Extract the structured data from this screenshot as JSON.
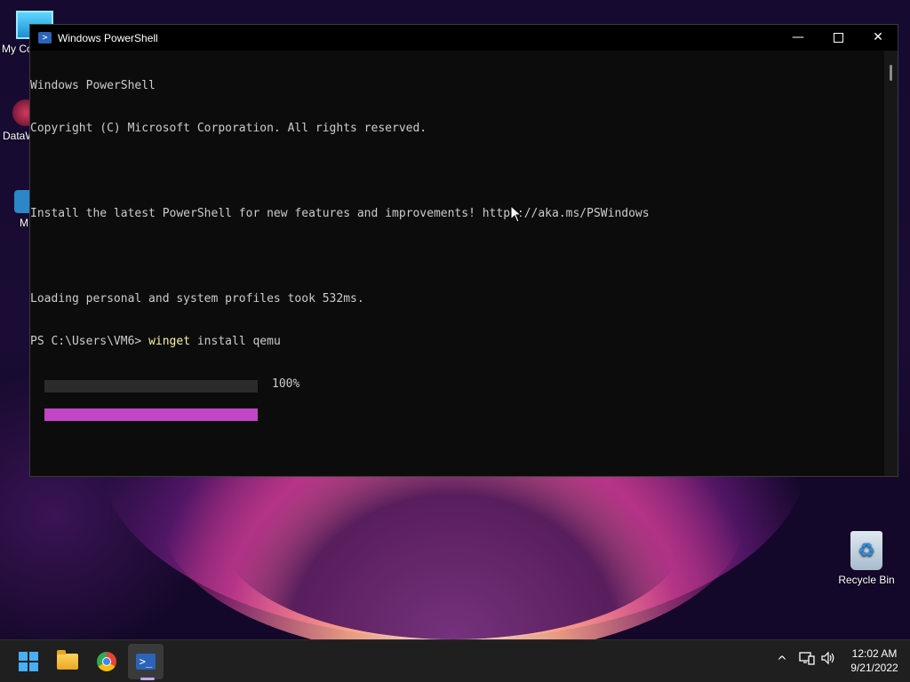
{
  "desktop": {
    "icons": [
      {
        "label": "My Co",
        "glyph": "computer-icon"
      },
      {
        "label": "DataW",
        "glyph": "app-shortcut-icon"
      },
      {
        "label": "M",
        "glyph": "app-shortcut-icon"
      },
      {
        "label": "Recycle Bin",
        "glyph": "recycle-bin-icon"
      }
    ]
  },
  "window": {
    "title": "Windows PowerShell",
    "icon": "powershell-icon",
    "controls": {
      "minimize": "—",
      "close": "✕"
    }
  },
  "console": {
    "lines": [
      "Windows PowerShell",
      "Copyright (C) Microsoft Corporation. All rights reserved.",
      "",
      "Install the latest PowerShell for new features and improvements! https://aka.ms/PSWindows",
      "",
      "Loading personal and system profiles took 532ms."
    ],
    "prompt": "PS C:\\Users\\VM6> ",
    "command": "winget",
    "command_args": " install qemu",
    "progress": {
      "percent": 100,
      "label": "100%",
      "fill_color": "#c146c6"
    }
  },
  "taskbar": {
    "buttons": [
      {
        "name": "start",
        "icon": "windows-logo-icon"
      },
      {
        "name": "file-explorer",
        "icon": "folder-icon"
      },
      {
        "name": "chrome",
        "icon": "chrome-icon"
      },
      {
        "name": "powershell",
        "icon": "powershell-icon",
        "active": true
      }
    ],
    "tray": {
      "chevron": "^",
      "icons": [
        "network-icon",
        "volume-icon"
      ],
      "time": "12:02 AM",
      "date": "9/21/2022"
    }
  },
  "colors": {
    "console_bg": "#0c0c0c",
    "console_text": "#cccccc",
    "command_highlight": "#f9f1a5",
    "taskbar_bg": "#1f1f1f"
  }
}
